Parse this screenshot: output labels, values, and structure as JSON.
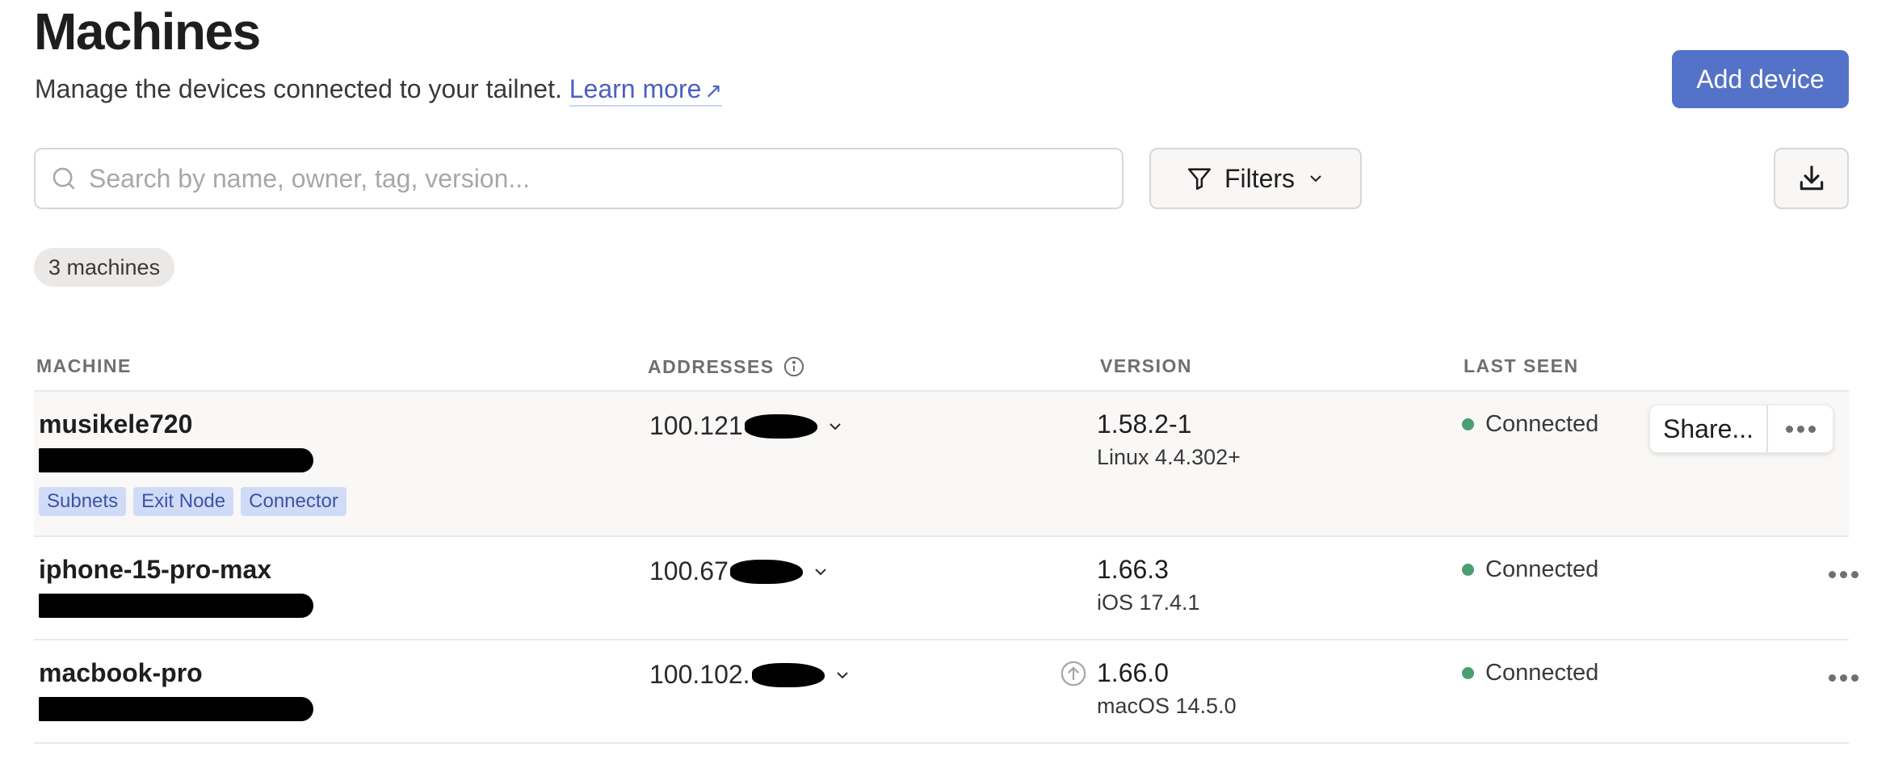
{
  "header": {
    "title": "Machines",
    "subtitle": "Manage the devices connected to your tailnet.",
    "learn_more": "Learn more",
    "learn_more_icon": "arrow-up-right-icon",
    "add_device": "Add device"
  },
  "toolbar": {
    "search_placeholder": "Search by name, owner, tag, version...",
    "search_value": "",
    "filters_label": "Filters",
    "download_icon": "download-icon"
  },
  "count_badge": "3 machines",
  "table": {
    "columns": {
      "machine": "MACHINE",
      "addresses": "ADDRESSES",
      "version": "VERSION",
      "last_seen": "LAST SEEN"
    },
    "rows": [
      {
        "name": "musikele720",
        "tags": [
          "Subnets",
          "Exit Node",
          "Connector"
        ],
        "address": "100.121",
        "version": "1.58.2-1",
        "os": "Linux 4.4.302+",
        "update_available": false,
        "status": "Connected",
        "share_label": "Share..."
      },
      {
        "name": "iphone-15-pro-max",
        "tags": [],
        "address": "100.67",
        "version": "1.66.3",
        "os": "iOS 17.4.1",
        "update_available": false,
        "status": "Connected"
      },
      {
        "name": "macbook-pro",
        "tags": [],
        "address": "100.102.",
        "version": "1.66.0",
        "os": "macOS 14.5.0",
        "update_available": true,
        "status": "Connected"
      }
    ]
  },
  "colors": {
    "accent": "#5472c8",
    "link": "#4b61bf",
    "status_connected": "#4a9e72",
    "tag_bg": "#d0dcf7",
    "tag_text": "#3d53a6",
    "row_highlight": "#f9f8f7"
  }
}
